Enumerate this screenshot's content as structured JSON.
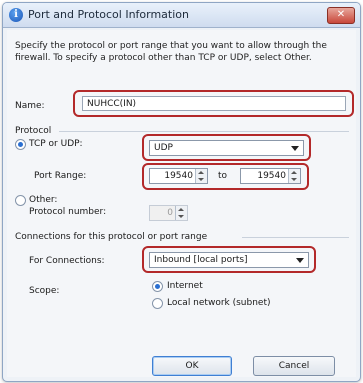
{
  "window": {
    "title": "Port and Protocol Information",
    "close_glyph": "✕",
    "icon_name": "info-shield-icon"
  },
  "description": "Specify the protocol or port range that you want to allow through the firewall. To specify a protocol other than TCP or UDP, select Other.",
  "name_field": {
    "label": "Name:",
    "value": "NUHCC(IN)"
  },
  "protocol": {
    "group_label": "Protocol",
    "tcp_udp_label": "TCP or UDP:",
    "tcp_udp_selected": true,
    "tcp_udp_value": "UDP",
    "port_range_label": "Port Range:",
    "port_from": "19540",
    "to_label": "to",
    "port_to": "19540",
    "other_label": "Other:",
    "other_selected": false,
    "protocol_number_label": "Protocol number:",
    "protocol_number_value": "0"
  },
  "connections": {
    "group_label": "Connections for this protocol or port range",
    "for_connections_label": "For Connections:",
    "for_connections_value": "Inbound [local ports]",
    "scope_label": "Scope:",
    "scope_internet_label": "Internet",
    "scope_internet_selected": true,
    "scope_local_label": "Local network (subnet)",
    "scope_local_selected": false
  },
  "buttons": {
    "ok": "OK",
    "cancel": "Cancel"
  },
  "colors": {
    "highlight": "#b3292a",
    "accent": "#2a6fd1"
  }
}
